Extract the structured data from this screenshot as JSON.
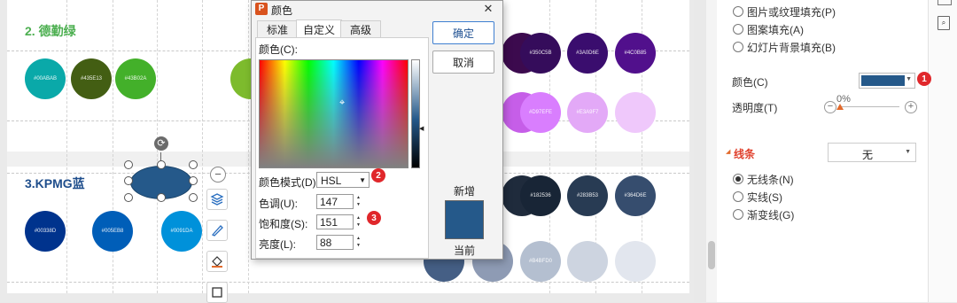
{
  "slide": {
    "heading_green": "2. 德勤绿",
    "heading_blue": "3.KPMG蓝",
    "green_circles": [
      {
        "label": "#00ABAB",
        "color": "#0aa9a9"
      },
      {
        "label": "#435E13",
        "color": "#435e13"
      },
      {
        "label": "#43B02A",
        "color": "#43b02a"
      },
      {
        "label": "",
        "color": "#7dbb2d"
      }
    ],
    "blue_circles": [
      {
        "label": "#00338D",
        "color": "#00338d"
      },
      {
        "label": "#005EB8",
        "color": "#005eb8"
      },
      {
        "label": "#0091DA",
        "color": "#0091da"
      }
    ],
    "purple_row1": [
      {
        "label": "",
        "color": "#3c0a4e"
      },
      {
        "label": "#350C5B",
        "color": "#350c5b"
      },
      {
        "label": "#3A0D6E",
        "color": "#3a0d6e"
      },
      {
        "label": "#4C0B85",
        "color": "#51108c"
      }
    ],
    "purple_row2": [
      {
        "label": "",
        "color": "#c65ee8"
      },
      {
        "label": "#D97EFE",
        "color": "#d97efe"
      },
      {
        "label": "#E3A9F7",
        "color": "#e3a9f7"
      },
      {
        "label": "",
        "color": "#efc8fb"
      }
    ],
    "navy_row": [
      {
        "label": "",
        "color": "#1f2b3c"
      },
      {
        "label": "#182536",
        "color": "#182536"
      },
      {
        "label": "#283B53",
        "color": "#283b53"
      },
      {
        "label": "#364D6E",
        "color": "#364d6e"
      }
    ],
    "grey_row": [
      {
        "label": "",
        "color": "#455f85"
      },
      {
        "label": "",
        "color": "#8e9bb4"
      },
      {
        "label": "#B4BFD0",
        "color": "#b4bfd0"
      },
      {
        "label": "",
        "color": "#cdd4e0"
      },
      {
        "label": "",
        "color": "#e2e6ee"
      }
    ],
    "selected_shape_color": "#25598a"
  },
  "dialog": {
    "title": "颜色",
    "close": "✕",
    "tabs": [
      "标准",
      "自定义",
      "高级"
    ],
    "color_label": "颜色(C):",
    "mode_label": "颜色模式(D)",
    "mode_value": "HSL",
    "hue_label": "色调(U):",
    "hue_value": "147",
    "sat_label": "饱和度(S):",
    "sat_value": "151",
    "lum_label": "亮度(L):",
    "lum_value": "88",
    "ok": "确定",
    "cancel": "取消",
    "new_label": "新增",
    "current_label": "当前",
    "preview_color": "#25598a"
  },
  "panel": {
    "fill_options": [
      "图片或纹理填充(P)",
      "图案填充(A)",
      "幻灯片背景填充(B)"
    ],
    "color_label": "颜色(C)",
    "swatch_color": "#25598a",
    "transparency_label": "透明度(T)",
    "transparency_value": "0%",
    "line_section": "线条",
    "line_value": "无",
    "line_options": [
      "无线条(N)",
      "实线(S)",
      "渐变线(G)"
    ]
  },
  "badges": [
    "1",
    "2",
    "3"
  ]
}
